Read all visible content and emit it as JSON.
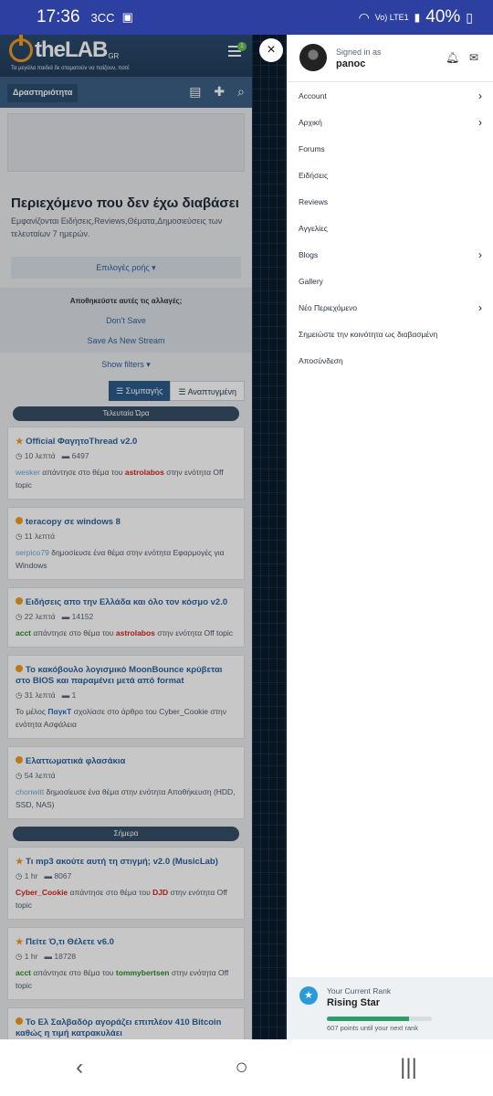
{
  "status": {
    "time": "17:36",
    "icons": [
      "3CC",
      "image-icon"
    ],
    "signal": "Vo) LTE1",
    "battery": "40%"
  },
  "site": {
    "logo": "theLAB",
    "logo_suffix": "GR",
    "tagline": "Τα μεγάλα παιδιά δε σταματούν να παίζουν, ποτέ",
    "notif_count": "1"
  },
  "subnav": {
    "activity": "Δραστηριότητα"
  },
  "intro": {
    "title": "Περιεχόμενο που δεν έχω διαβάσει",
    "desc": "Εμφανίζονται Ειδήσεις,Reviews,Θέματα,Δημοσιεύσεις των τελευταίων 7 ημερών."
  },
  "feed": {
    "options": "Επιλογές ροής ▾",
    "save_q": "Αποθηκεύστε αυτές τις αλλαγές;",
    "dont_save": "Don't Save",
    "save_new": "Save As New Stream",
    "show_filters": "Show filters ▾",
    "compact": "Συμπαγής",
    "expanded": "Αναπτυγμένη"
  },
  "groups": {
    "last_hour": "Τελευταία Ώρα",
    "today": "Σήμερα"
  },
  "items": [
    {
      "title": "Official ΦαγητοThread v2.0",
      "time": "10 λεπτά",
      "count": "6497",
      "user": "wesker",
      "mid": " απάντησε στο θέμα του ",
      "user2": "astrolabos",
      "tail": " στην ενότητα Off topic"
    },
    {
      "title": "teracopy σε windows 8",
      "time": "11 λεπτά",
      "count": "",
      "user": "serpico79",
      "mid": " δημοσίευσε ένα θέμα στην ενότητα Εφαρμογές για Windows",
      "user2": "",
      "tail": ""
    },
    {
      "title": "Ειδήσεις απο την Ελλάδα και όλο τον κόσμο v2.0",
      "time": "22 λεπτά",
      "count": "14152",
      "user": "acct",
      "mid": " απάντησε στο θέμα του ",
      "user2": "astrolabos",
      "tail": " στην ενότητα Off topic"
    },
    {
      "title": "Το κακόβουλο λογισμικό MoonBounce κρύβεται στο BIOS και παραμένει μετά από format",
      "time": "31 λεπτά",
      "count": "1",
      "user": "",
      "mid": "Το μέλος ",
      "user2": "ΠαγκΤ",
      "tail": " σχολίασε στο άρθρο του Cyber_Cookie στην ενότητα Ασφάλεια"
    },
    {
      "title": "Ελαττωματικά φλασάκια",
      "time": "54 λεπτά",
      "count": "",
      "user": "chonwitt",
      "mid": " δημοσίευσε ένα θέμα στην ενότητα Αποθήκευση (HDD, SSD, NAS)",
      "user2": "",
      "tail": ""
    },
    {
      "title": "Τι mp3 ακούτε αυτή τη στιγμή; v2.0 (MusicLab)",
      "time": "1 hr",
      "count": "8067",
      "user": "Cyber_Cookie",
      "mid": " απάντησε στο θέμα του ",
      "user2": "DJD",
      "tail": " στην ενότητα Off topic"
    },
    {
      "title": "Πείτε Ό,τι Θέλετε v6.0",
      "time": "1 hr",
      "count": "18728",
      "user": "acct",
      "mid": " απάντησε στο θέμα του ",
      "user2": "tommybertsen",
      "tail": " στην ενότητα Off topic"
    },
    {
      "title": "Το Ελ Σαλβαδόρ αγοράζει επιπλέον 410 Bitcoin καθώς η τιμή κατρακυλάει",
      "time": "",
      "count": "",
      "user": "",
      "mid": "",
      "user2": "",
      "tail": ""
    }
  ],
  "drawer": {
    "signed_in_as": "Signed in as",
    "username": "panoc",
    "menu": [
      "Account",
      "Αρχική",
      "Forums",
      "Ειδήσεις",
      "Reviews",
      "Αγγελίες",
      "Blogs",
      "Gallery",
      "Νέο Περιεχόμενο",
      "Σημειώστε την κοινότητα ως διαβασμένη",
      "Αποσύνδεση"
    ]
  },
  "rank": {
    "label": "Your Current Rank",
    "name": "Rising Star",
    "points": "607 points until your next rank",
    "progress": 0.78
  },
  "close": "×"
}
